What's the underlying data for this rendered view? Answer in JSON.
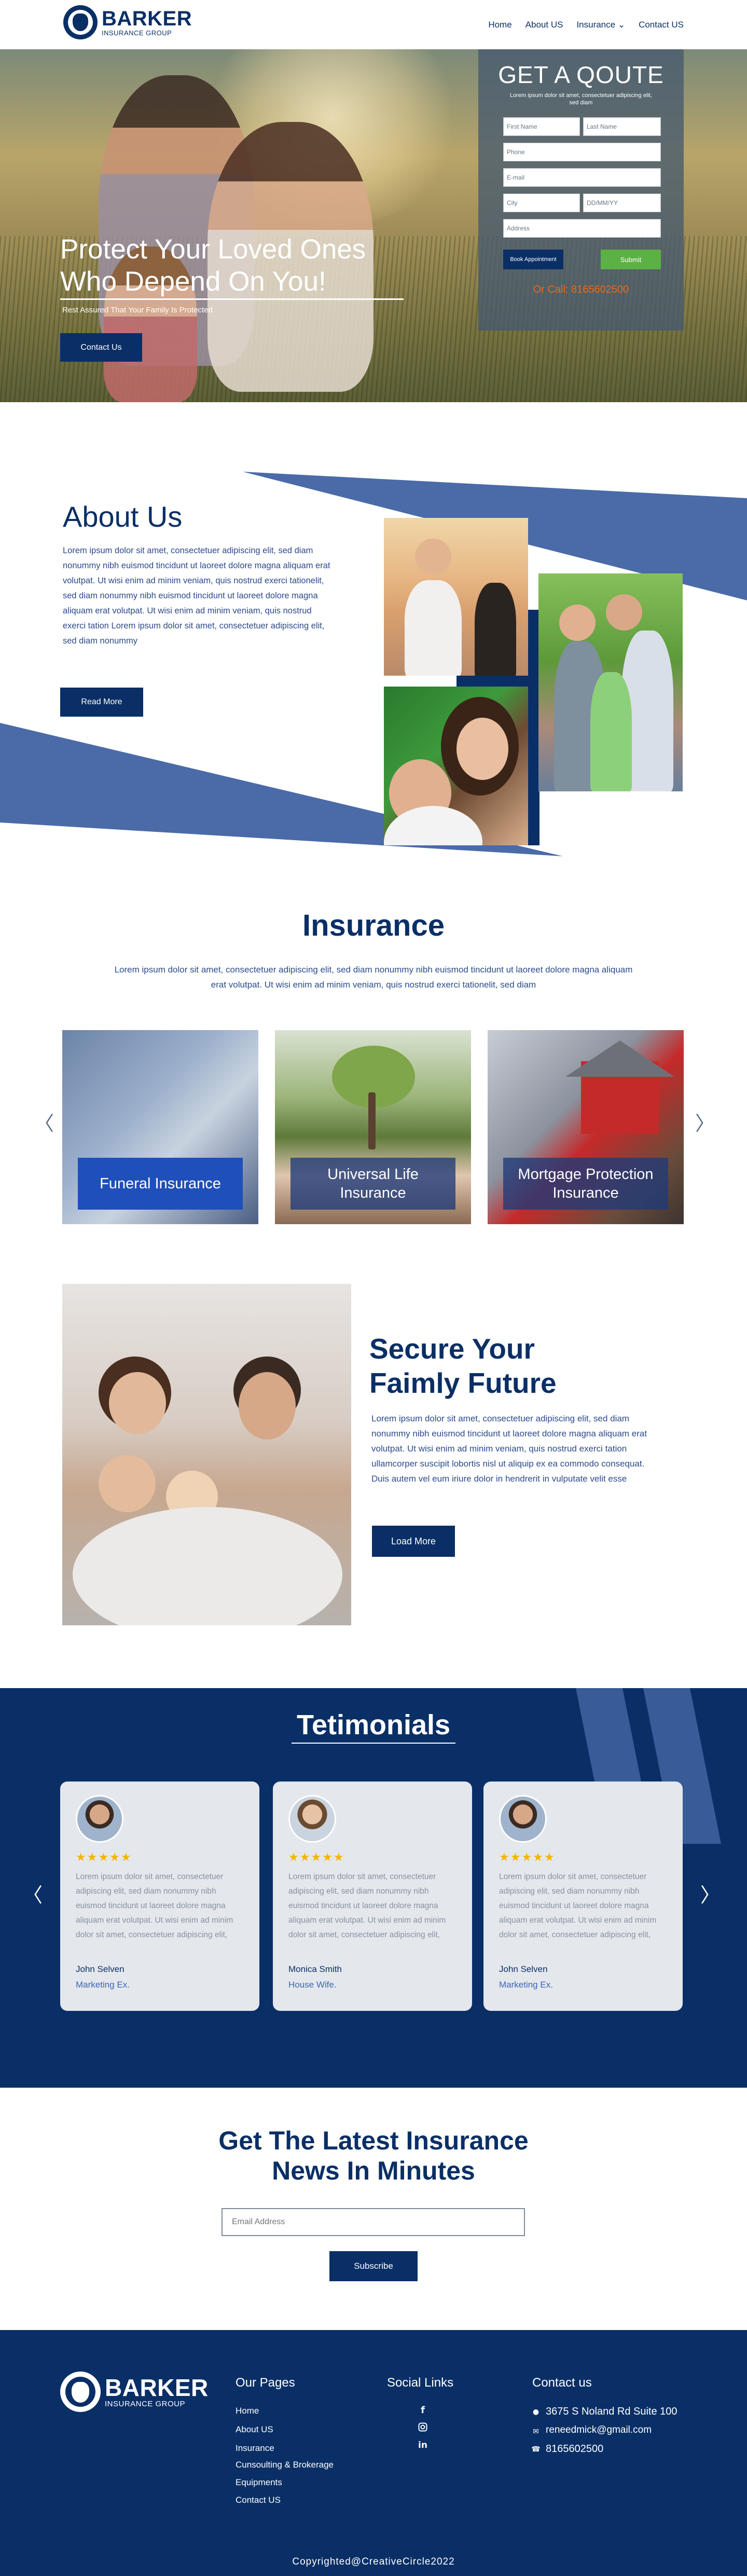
{
  "brand": {
    "name": "BARKER",
    "tagline": "INSURANCE GROUP"
  },
  "nav": [
    {
      "label": "Home"
    },
    {
      "label": "About US"
    },
    {
      "label": "Insurance ⌄"
    },
    {
      "label": "Contact US"
    }
  ],
  "hero": {
    "title": "Protect Your Loved Ones\nWho Depend On You!",
    "subtitle": "Rest Assured That Your Family Is Protected",
    "cta": "Contact Us"
  },
  "quote_form": {
    "title": "GET A QOUTE",
    "subtitle": "Lorem ipsum dolor sit amet, consectetuer adipiscing elit, sed diam",
    "first_name": "First Name",
    "last_name": "Last Name",
    "phone": "Phone",
    "email": "E-mail",
    "city": "City",
    "date": "DD/MM/YY",
    "address": "Address",
    "book_label": "Book Appointment",
    "submit_label": "Submit",
    "call_text": "Or Call: 8165602500"
  },
  "about": {
    "title": "About Us",
    "text": "Lorem ipsum dolor sit amet, consectetuer adipiscing elit, sed diam nonummy nibh euismod tincidunt ut laoreet dolore magna aliquam erat volutpat. Ut wisi enim ad minim veniam, quis nostrud exerci tationelit, sed diam nonummy nibh euismod tincidunt ut laoreet dolore magna aliquam erat volutpat. Ut wisi enim ad minim veniam, quis nostrud exerci tation Lorem ipsum dolor sit amet, consectetuer adipiscing elit, sed diam nonummy",
    "button": "Read More"
  },
  "insurance": {
    "title": "Insurance",
    "subtitle": "Lorem ipsum dolor sit amet, consectetuer adipiscing elit, sed diam nonummy nibh euismod tincidunt ut laoreet dolore magna aliquam erat volutpat. Ut wisi enim ad minim veniam, quis nostrud exerci tationelit, sed diam",
    "cards": [
      {
        "label": "Funeral Insurance"
      },
      {
        "label": "Universal Life\nInsurance"
      },
      {
        "label": "Mortgage Protection\nInsurance"
      }
    ],
    "prev_arrow": "〈",
    "next_arrow": "〉"
  },
  "secure": {
    "title": "Secure Your\nFaimly Future",
    "text": "Lorem ipsum dolor sit amet, consectetuer adipiscing elit, sed diam nonummy nibh euismod tincidunt ut laoreet dolore magna aliquam erat volutpat. Ut wisi enim ad minim veniam, quis nostrud exerci tation ullamcorper suscipit lobortis nisl ut aliquip ex ea commodo consequat. Duis autem vel eum iriure dolor in hendrerit in vulputate velit esse",
    "button": "Load More"
  },
  "testimonials": {
    "title": "Tetimonials",
    "items": [
      {
        "stars": "★★★★★",
        "text": "Lorem ipsum dolor sit amet, consectetuer adipiscing elit, sed diam nonummy nibh euismod tincidunt ut laoreet dolore magna aliquam erat volutpat. Ut wisi enim ad minim dolor sit amet, consectetuer adipiscing elit,",
        "name": "John Selven",
        "role": "Marketing Ex."
      },
      {
        "stars": "★★★★★",
        "text": "Lorem ipsum dolor sit amet, consectetuer adipiscing elit, sed diam nonummy nibh euismod tincidunt ut laoreet dolore magna aliquam erat volutpat. Ut wisi enim ad minim dolor sit amet, consectetuer adipiscing elit,",
        "name": "Monica Smith",
        "role": "House Wife."
      },
      {
        "stars": "★★★★★",
        "text": "Lorem ipsum dolor sit amet, consectetuer adipiscing elit, sed diam nonummy nibh euismod tincidunt ut laoreet dolore magna aliquam erat volutpat. Ut wisi enim ad minim dolor sit amet, consectetuer adipiscing elit,",
        "name": "John Selven",
        "role": "Marketing Ex."
      }
    ],
    "prev_arrow": "〈",
    "next_arrow": "〉"
  },
  "newsletter": {
    "title": "Get The Latest  Insurance\nNews In Minutes",
    "placeholder": "Email Address",
    "button": "Subscribe"
  },
  "footer": {
    "pages_title": "Our Pages",
    "pages": [
      "Home",
      "About US",
      "Insurance",
      "Cunsoulting & Brokerage",
      "Equipments",
      "Contact US"
    ],
    "social_title": "Social Links",
    "social_icons": [
      "facebook-icon",
      "instagram-icon",
      "linkedin-icon"
    ],
    "contact_title": "Contact us",
    "address": "3675 S Noland Rd Suite 100",
    "email": "reneedmick@gmail.com",
    "phone": "8165602500",
    "copyright": "Copyrighted@CreativeCircle2022"
  },
  "colors": {
    "primary": "#0a2f66",
    "accent": "#1f4fba",
    "submit": "#5cb144",
    "call": "#e86a1c",
    "stars": "#f5b400"
  }
}
